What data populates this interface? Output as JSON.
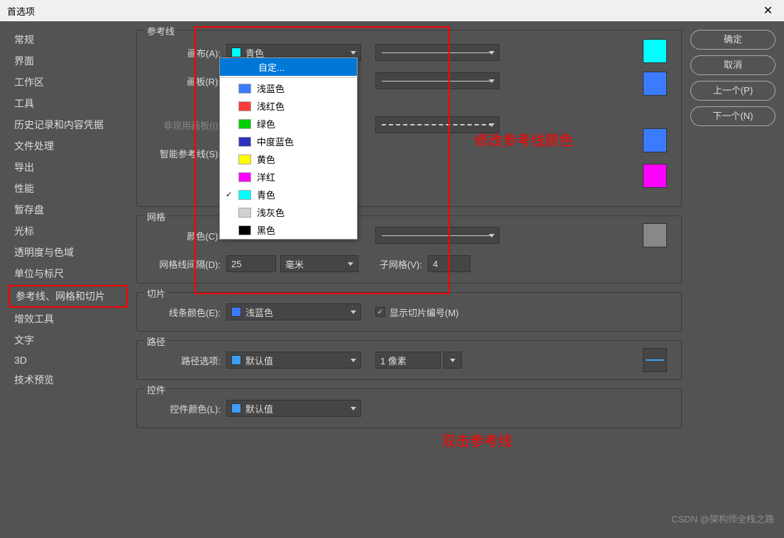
{
  "title": "首选项",
  "sidebar": {
    "items": [
      "常规",
      "界面",
      "工作区",
      "工具",
      "历史记录和内容凭据",
      "文件处理",
      "导出",
      "性能",
      "暂存盘",
      "光标",
      "透明度与色域",
      "单位与标尺",
      "参考线、网格和切片",
      "增效工具",
      "文字",
      "3D",
      "技术预览"
    ],
    "selected_index": 12
  },
  "buttons": {
    "ok": "确定",
    "cancel": "取消",
    "prev": "上一个(P)",
    "next": "下一个(N)"
  },
  "sections": {
    "guides": {
      "title": "参考线",
      "canvas_label": "画布(A):",
      "canvas_value": "青色",
      "artboard_label": "画板(R):",
      "inactive_label": "非现用画板(I):",
      "smart_label": "智能参考线(S):",
      "colors": {
        "canvas": "#00ffff",
        "artboard": "#3a7bff",
        "inactive": "#3a7bff",
        "smart": "#ff00ff"
      }
    },
    "grid": {
      "title": "网格",
      "color_label": "颜色(C):",
      "gridline_label": "网格线间隔(D):",
      "gridline_value": "25",
      "unit": "毫米",
      "subgrid_label": "子网格(V):",
      "subgrid_value": "4",
      "color": "#888888"
    },
    "slices": {
      "title": "切片",
      "color_label": "线条颜色(E):",
      "color_value": "浅蓝色",
      "show_numbers": "显示切片编号(M)",
      "checked": true
    },
    "path": {
      "title": "路径",
      "option_label": "路径选项:",
      "option_value": "默认值",
      "pixel_value": "1 像素",
      "color": "#3a9ff5"
    },
    "controls": {
      "title": "控件",
      "color_label": "控件颜色(L):",
      "color_value": "默认值",
      "color": "#3a9ff5"
    }
  },
  "dropdown": {
    "custom": "自定...",
    "items": [
      {
        "label": "浅蓝色",
        "color": "#3a7bff"
      },
      {
        "label": "浅红色",
        "color": "#ff3a3a"
      },
      {
        "label": "绿色",
        "color": "#00d000"
      },
      {
        "label": "中度蓝色",
        "color": "#3030c0"
      },
      {
        "label": "黄色",
        "color": "#ffff00"
      },
      {
        "label": "洋红",
        "color": "#ff00ff"
      },
      {
        "label": "青色",
        "color": "#00ffff",
        "checked": true
      },
      {
        "label": "浅灰色",
        "color": "#d0d0d0"
      },
      {
        "label": "黑色",
        "color": "#000000"
      }
    ]
  },
  "annotations": {
    "modify_guide_color": "修改参考线颜色",
    "doubleclick_guide": "双击参考线"
  },
  "watermark": "CSDN @架构师全栈之路"
}
